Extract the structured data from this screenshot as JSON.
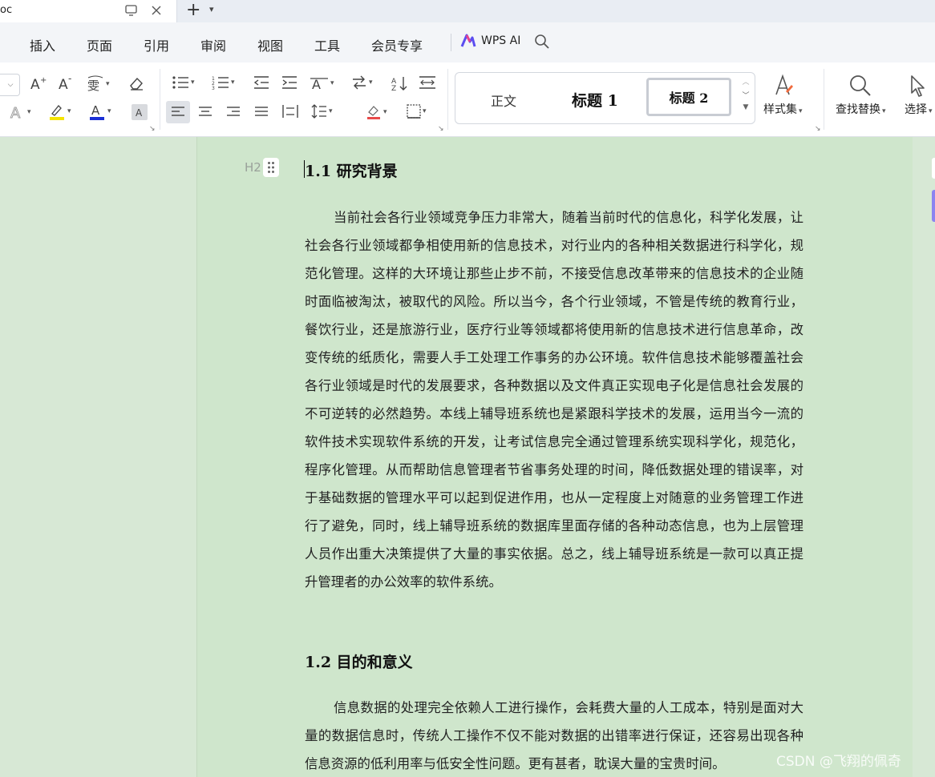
{
  "tab": {
    "title": "oc"
  },
  "menubar": {
    "items": [
      "插入",
      "页面",
      "引用",
      "审阅",
      "视图",
      "工具",
      "会员专享"
    ],
    "ai_label": "WPS AI"
  },
  "ribbon": {
    "styles": {
      "normal": "正文",
      "heading1": "标题 1",
      "heading2": "标题 2"
    },
    "style_set_label": "样式集",
    "find_replace_label": "查找替换",
    "select_label": "选择"
  },
  "document": {
    "margin_marker": "H2",
    "section1": {
      "heading": "1.1  研究背景",
      "body": "当前社会各行业领域竞争压力非常大，随着当前时代的信息化，科学化发展，让社会各行业领域都争相使用新的信息技术，对行业内的各种相关数据进行科学化，规范化管理。这样的大环境让那些止步不前，不接受信息改革带来的信息技术的企业随时面临被淘汰，被取代的风险。所以当今，各个行业领域，不管是传统的教育行业，餐饮行业，还是旅游行业，医疗行业等领域都将使用新的信息技术进行信息革命，改变传统的纸质化，需要人手工处理工作事务的办公环境。软件信息技术能够覆盖社会各行业领域是时代的发展要求，各种数据以及文件真正实现电子化是信息社会发展的不可逆转的必然趋势。本线上辅导班系统也是紧跟科学技术的发展，运用当今一流的软件技术实现软件系统的开发，让考试信息完全通过管理系统实现科学化，规范化，程序化管理。从而帮助信息管理者节省事务处理的时间，降低数据处理的错误率，对于基础数据的管理水平可以起到促进作用，也从一定程度上对随意的业务管理工作进行了避免，同时，线上辅导班系统的数据库里面存储的各种动态信息，也为上层管理人员作出重大决策提供了大量的事实依据。总之，线上辅导班系统是一款可以真正提升管理者的办公效率的软件系统。"
    },
    "section2": {
      "heading": "1.2  目的和意义",
      "body": "信息数据的处理完全依赖人工进行操作，会耗费大量的人工成本，特别是面对大量的数据信息时，传统人工操作不仅不能对数据的出错率进行保证，还容易出现各种信息资源的低利用率与低安全性问题。更有甚者，耽误大量的宝贵时间。"
    }
  },
  "watermark": "CSDN @飞翔的佩奇",
  "colors": {
    "page_bg": "#cfe6cc",
    "accent": "#8c84f0",
    "highlight": "#f5e400",
    "font_color": "#1a2fd6"
  }
}
